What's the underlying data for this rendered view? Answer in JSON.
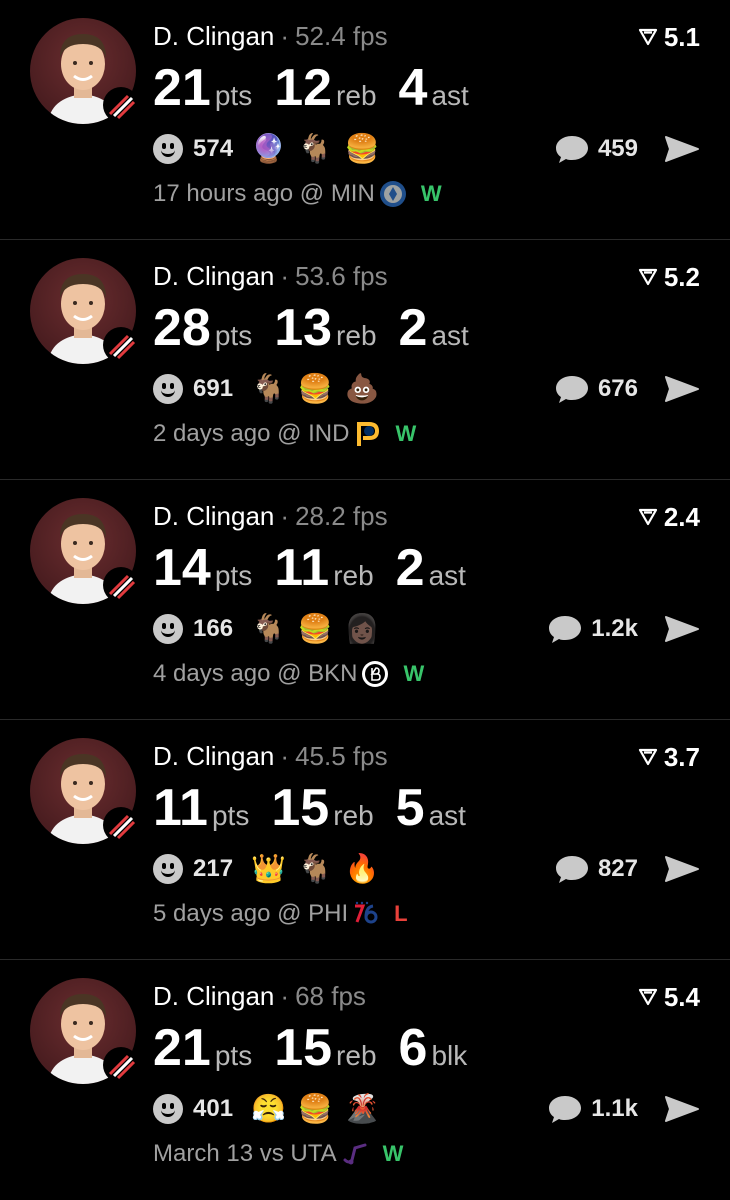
{
  "cards": [
    {
      "player": "D. Clingan",
      "fps": "52.4 fps",
      "rating": "5.1",
      "stats": [
        {
          "value": "21",
          "label": "pts"
        },
        {
          "value": "12",
          "label": "reb"
        },
        {
          "value": "4",
          "label": "ast"
        }
      ],
      "reaction_count": "574",
      "emojis": [
        "🔮",
        "🐐",
        "🍔"
      ],
      "comment_count": "459",
      "time": "17 hours ago",
      "venue": "@ MIN",
      "opponent_logo": "timberwolves-logo",
      "result": "W"
    },
    {
      "player": "D. Clingan",
      "fps": "53.6 fps",
      "rating": "5.2",
      "stats": [
        {
          "value": "28",
          "label": "pts"
        },
        {
          "value": "13",
          "label": "reb"
        },
        {
          "value": "2",
          "label": "ast"
        }
      ],
      "reaction_count": "691",
      "emojis": [
        "🐐",
        "🍔",
        "💩"
      ],
      "comment_count": "676",
      "time": "2 days ago",
      "venue": "@ IND",
      "opponent_logo": "pacers-logo",
      "result": "W"
    },
    {
      "player": "D. Clingan",
      "fps": "28.2 fps",
      "rating": "2.4",
      "stats": [
        {
          "value": "14",
          "label": "pts"
        },
        {
          "value": "11",
          "label": "reb"
        },
        {
          "value": "2",
          "label": "ast"
        }
      ],
      "reaction_count": "166",
      "emojis": [
        "🐐",
        "🍔",
        "👩🏿"
      ],
      "comment_count": "1.2k",
      "time": "4 days ago",
      "venue": "@ BKN",
      "opponent_logo": "nets-logo",
      "result": "W"
    },
    {
      "player": "D. Clingan",
      "fps": "45.5 fps",
      "rating": "3.7",
      "stats": [
        {
          "value": "11",
          "label": "pts"
        },
        {
          "value": "15",
          "label": "reb"
        },
        {
          "value": "5",
          "label": "ast"
        }
      ],
      "reaction_count": "217",
      "emojis": [
        "👑",
        "🐐",
        "🔥"
      ],
      "comment_count": "827",
      "time": "5 days ago",
      "venue": "@ PHI",
      "opponent_logo": "76ers-logo",
      "result": "L"
    },
    {
      "player": "D. Clingan",
      "fps": "68 fps",
      "rating": "5.4",
      "stats": [
        {
          "value": "21",
          "label": "pts"
        },
        {
          "value": "15",
          "label": "reb"
        },
        {
          "value": "6",
          "label": "blk"
        }
      ],
      "reaction_count": "401",
      "emojis": [
        "😤",
        "🍔",
        "🌋"
      ],
      "comment_count": "1.1k",
      "time": "March 13",
      "venue": "vs UTA",
      "opponent_logo": "jazz-logo",
      "result": "W"
    }
  ],
  "colors": {
    "win": "#38c46a",
    "loss": "#e8413a",
    "muted": "#8a8a8a",
    "avatar_bg": "#4a1d20"
  }
}
